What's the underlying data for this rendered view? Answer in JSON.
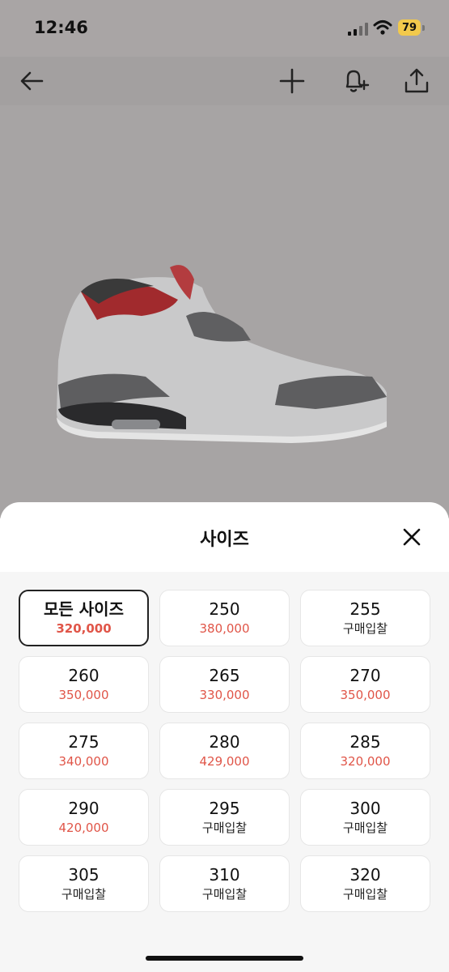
{
  "status_bar": {
    "time": "12:46",
    "battery": "79"
  },
  "top_bar": {
    "icons": [
      "back-arrow-icon",
      "plus-icon",
      "bell-plus-icon",
      "share-icon"
    ]
  },
  "sheet": {
    "title": "사이즈",
    "close_icon": "close-icon",
    "sizes": [
      {
        "size": "모든 사이즈",
        "price": "320,000",
        "kind": "price",
        "selected": true
      },
      {
        "size": "250",
        "price": "380,000",
        "kind": "price"
      },
      {
        "size": "255",
        "price": "구매입찰",
        "kind": "bid"
      },
      {
        "size": "260",
        "price": "350,000",
        "kind": "price"
      },
      {
        "size": "265",
        "price": "330,000",
        "kind": "price"
      },
      {
        "size": "270",
        "price": "350,000",
        "kind": "price"
      },
      {
        "size": "275",
        "price": "340,000",
        "kind": "price"
      },
      {
        "size": "280",
        "price": "429,000",
        "kind": "price"
      },
      {
        "size": "285",
        "price": "320,000",
        "kind": "price"
      },
      {
        "size": "290",
        "price": "420,000",
        "kind": "price"
      },
      {
        "size": "295",
        "price": "구매입찰",
        "kind": "bid"
      },
      {
        "size": "300",
        "price": "구매입찰",
        "kind": "bid"
      },
      {
        "size": "305",
        "price": "구매입찰",
        "kind": "bid"
      },
      {
        "size": "310",
        "price": "구매입찰",
        "kind": "bid"
      },
      {
        "size": "320",
        "price": "구매입찰",
        "kind": "bid"
      }
    ]
  },
  "colors": {
    "price_red": "#e05548",
    "backdrop": "#a7a4a4",
    "battery": "#f2c94c"
  }
}
